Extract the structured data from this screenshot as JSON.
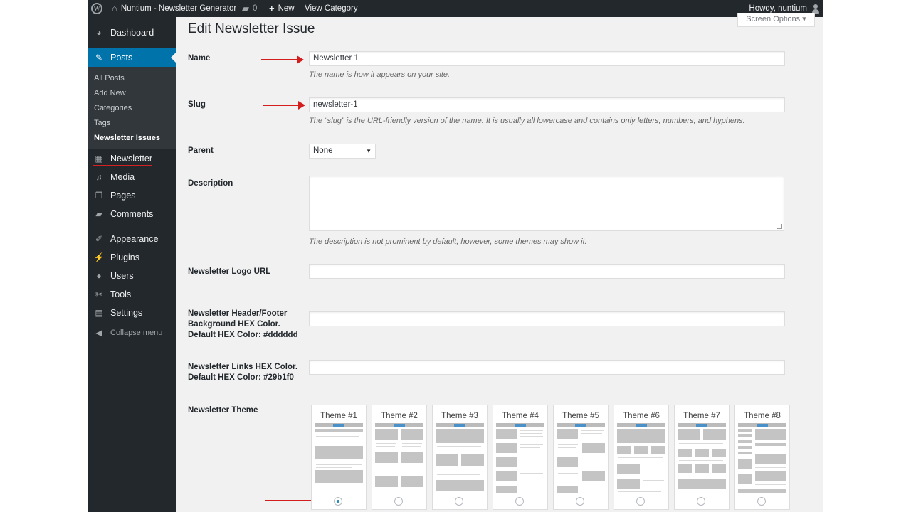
{
  "adminbar": {
    "site_name": "Nuntium - Newsletter Generator",
    "comments_count": "0",
    "new_label": "New",
    "view_label": "View Category",
    "howdy": "Howdy, nuntium"
  },
  "sidebar": {
    "dashboard": "Dashboard",
    "posts": "Posts",
    "sub": [
      "All Posts",
      "Add New",
      "Categories",
      "Tags",
      "Newsletter Issues"
    ],
    "newsletter": "Newsletter",
    "media": "Media",
    "pages": "Pages",
    "comments": "Comments",
    "appearance": "Appearance",
    "plugins": "Plugins",
    "users": "Users",
    "tools": "Tools",
    "settings": "Settings",
    "collapse": "Collapse menu"
  },
  "page": {
    "title": "Edit Newsletter Issue",
    "screen_options": "Screen Options"
  },
  "form": {
    "name_label": "Name",
    "name_value": "Newsletter 1",
    "name_desc": "The name is how it appears on your site.",
    "slug_label": "Slug",
    "slug_value": "newsletter-1",
    "slug_desc": "The “slug” is the URL-friendly version of the name. It is usually all lowercase and contains only letters, numbers, and hyphens.",
    "parent_label": "Parent",
    "parent_value": "None",
    "description_label": "Description",
    "description_value": "",
    "description_desc": "The description is not prominent by default; however, some themes may show it.",
    "logo_label": "Newsletter Logo URL",
    "logo_value": "",
    "header_label_1": "Newsletter Header/Footer",
    "header_label_2": "Background HEX Color.",
    "header_label_3": "Default HEX Color: #dddddd",
    "header_value": "",
    "links_label_1": "Newsletter Links HEX Color.",
    "links_label_2": "Default HEX Color: #29b1f0",
    "links_value": "",
    "theme_label": "Newsletter Theme",
    "themes": [
      "Theme #1",
      "Theme #2",
      "Theme #3",
      "Theme #4",
      "Theme #5",
      "Theme #6",
      "Theme #7",
      "Theme #8"
    ],
    "selected_theme": "Theme #1"
  },
  "colors": {
    "admin_dark": "#23282d",
    "accent": "#0073aa",
    "annotation_red": "#d41d1d"
  }
}
